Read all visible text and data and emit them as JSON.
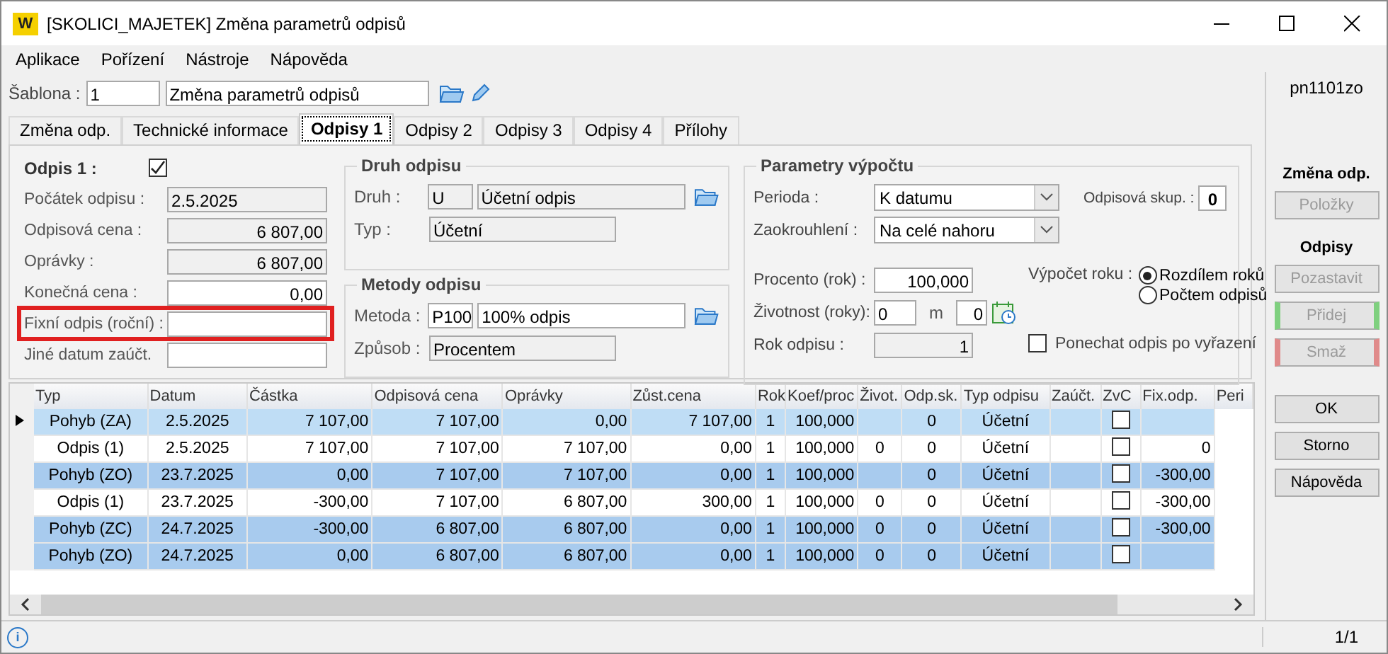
{
  "window": {
    "title": "[SKOLICI_MAJETEK] Změna parametrů odpisů",
    "logo": "W"
  },
  "menu": [
    "Aplikace",
    "Pořízení",
    "Nástroje",
    "Nápověda"
  ],
  "toolbar": {
    "label": "Šablona :",
    "code": "1",
    "name": "Změna parametrů odpisů"
  },
  "tabs": [
    {
      "label": "Změna odp.",
      "selected": false
    },
    {
      "label": "Technické informace",
      "selected": false
    },
    {
      "label": "Odpisy 1",
      "selected": true
    },
    {
      "label": "Odpisy 2",
      "selected": false
    },
    {
      "label": "Odpisy 3",
      "selected": false
    },
    {
      "label": "Odpisy 4",
      "selected": false
    },
    {
      "label": "Přílohy",
      "selected": false
    }
  ],
  "odpis": {
    "label": "Odpis 1 :",
    "checked": true,
    "fields": [
      {
        "label": "Počátek odpisu :",
        "value": "2.5.2025",
        "kind": "date",
        "readonly": true,
        "highlighted": false
      },
      {
        "label": "Odpisová cena :",
        "value": "6 807,00",
        "kind": "amount",
        "readonly": true,
        "highlighted": false
      },
      {
        "label": "Oprávky :",
        "value": "6 807,00",
        "kind": "amount",
        "readonly": true,
        "highlighted": false
      },
      {
        "label": "Konečná cena :",
        "value": "0,00",
        "kind": "amount",
        "readonly": false,
        "highlighted": false
      },
      {
        "label": "Fixní odpis (roční) :",
        "kind": "amount",
        "readonly": false,
        "highlighted": true
      },
      {
        "label": "Jiné datum zaúčt.",
        "kind": "date",
        "readonly": false,
        "highlighted": false
      }
    ]
  },
  "druh": {
    "title": "Druh odpisu",
    "druh_label": "Druh :",
    "druh_code": "U",
    "druh_name": "Účetní odpis",
    "typ_label": "Typ :",
    "typ_value": "Účetní"
  },
  "metody": {
    "title": "Metody odpisu",
    "metoda_label": "Metoda :",
    "metoda_code": "P100",
    "metoda_name": "100% odpis",
    "zpusob_label": "Způsob :",
    "zpusob_value": "Procentem"
  },
  "parametry": {
    "title": "Parametry výpočtu",
    "perioda_label": "Perioda :",
    "perioda": "K datumu",
    "skup_label": "Odpisová skup. :",
    "skup": "0",
    "zaokr_label": "Zaokrouhlení :",
    "zaokr": "Na celé nahoru",
    "procento_label": "Procento (rok) :",
    "procento": "100,000",
    "vypocet_label": "Výpočet roku :",
    "radios": [
      {
        "label": "Rozdílem roků",
        "selected": true
      },
      {
        "label": "Počtem odpisů",
        "selected": false
      }
    ],
    "zivotnost_label": "Životnost (roky):",
    "zivotnost_roky": "0",
    "m_label": "m",
    "zivotnost_m": "0",
    "rok_label": "Rok odpisu :",
    "rok": "1",
    "ponechat_label": "Ponechat odpis po vyřazení",
    "ponechat_checked": false
  },
  "table": {
    "columns": [
      "Typ",
      "Datum",
      "Částka",
      "Odpisová cena",
      "Oprávky",
      "Zůst.cena",
      "Rok",
      "Koef/proc",
      "Život.",
      "Odp.sk.",
      "Typ odpisu",
      "Zaúčt.",
      "ZvC",
      "Fix.odp.",
      "Peri"
    ],
    "rows": [
      {
        "kind": "pohyb",
        "selected": true,
        "cells": [
          "Pohyb (ZA)",
          "2.5.2025",
          "7 107,00",
          "7 107,00",
          "0,00",
          "7 107,00",
          "1",
          "100,000",
          null,
          "0",
          "Účetní",
          null,
          null,
          null
        ],
        "zvc": false
      },
      {
        "kind": "odpis",
        "selected": false,
        "cells": [
          "Odpis (1)",
          "2.5.2025",
          "7 107,00",
          "7 107,00",
          "7 107,00",
          "0,00",
          "1",
          "100,000",
          "0",
          "0",
          "Účetní",
          null,
          null,
          "0"
        ],
        "zvc": false
      },
      {
        "kind": "pohyb",
        "selected": false,
        "cells": [
          "Pohyb (ZO)",
          "23.7.2025",
          "0,00",
          "7 107,00",
          "7 107,00",
          "0,00",
          "1",
          "100,000",
          null,
          "0",
          "Účetní",
          null,
          null,
          "-300,00"
        ],
        "zvc": false
      },
      {
        "kind": "odpis",
        "selected": false,
        "cells": [
          "Odpis (1)",
          "23.7.2025",
          "-300,00",
          "7 107,00",
          "6 807,00",
          "300,00",
          "1",
          "100,000",
          "0",
          "0",
          "Účetní",
          null,
          null,
          "-300,00"
        ],
        "zvc": false
      },
      {
        "kind": "pohyb",
        "selected": false,
        "cells": [
          "Pohyb (ZC)",
          "24.7.2025",
          "-300,00",
          "6 807,00",
          "6 807,00",
          "0,00",
          "1",
          "100,000",
          "0",
          "0",
          "Účetní",
          null,
          null,
          "-300,00"
        ],
        "zvc": false
      },
      {
        "kind": "pohyb",
        "selected": false,
        "cells": [
          "Pohyb (ZO)",
          "24.7.2025",
          "0,00",
          "6 807,00",
          "6 807,00",
          "0,00",
          "1",
          "100,000",
          "0",
          "0",
          "Účetní",
          null,
          null,
          null
        ],
        "zvc": false
      }
    ]
  },
  "sidebar": {
    "code": "pn1101zo",
    "sections": [
      {
        "title": "Změna odp.",
        "buttons": [
          {
            "label": "Položky",
            "disabled": true
          }
        ]
      },
      {
        "title": "Odpisy",
        "buttons": [
          {
            "label": "Pozastavit",
            "disabled": true
          },
          {
            "label": "Přidej",
            "disabled": true,
            "color": "#7fd07f"
          },
          {
            "label": "Smaž",
            "disabled": true,
            "color": "#e08a8a"
          }
        ]
      }
    ],
    "buttons": [
      {
        "label": "OK",
        "disabled": false
      },
      {
        "label": "Storno",
        "disabled": false
      },
      {
        "label": "Nápověda",
        "disabled": false
      }
    ]
  },
  "status_bar": {
    "info": "i",
    "page": "1/1"
  }
}
